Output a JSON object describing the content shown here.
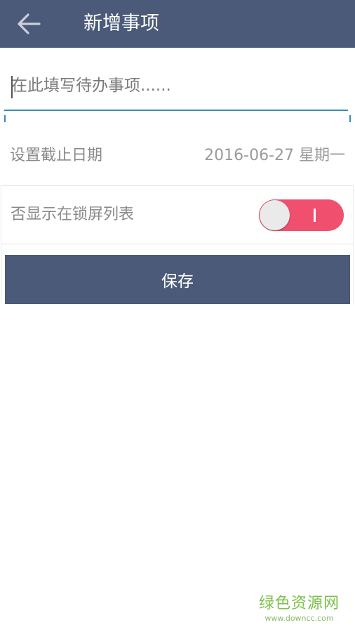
{
  "header": {
    "title": "新增事项",
    "back_icon": "arrow-left-icon",
    "background_color": "#4a5a78"
  },
  "form": {
    "todo_input": {
      "placeholder": "在此填写待办事项......",
      "value": ""
    },
    "deadline": {
      "label": "设置截止日期",
      "value": "2016-06-27 星期一"
    },
    "lock_screen": {
      "label": "否显示在锁屏列表",
      "enabled": true,
      "toggle_color": "#f0506e"
    },
    "save_button": {
      "label": "保存"
    }
  },
  "watermark": {
    "name": "绿色资源网",
    "url": "www.downcc.com"
  }
}
